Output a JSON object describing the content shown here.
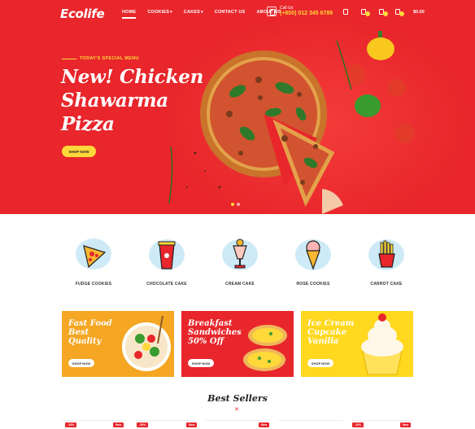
{
  "header": {
    "logo": "Ecolife",
    "nav": [
      {
        "label": "HOME",
        "caret": false,
        "active": true
      },
      {
        "label": "COOKIES",
        "caret": true,
        "active": false
      },
      {
        "label": "CAKES",
        "caret": true,
        "active": false
      },
      {
        "label": "CONTACT US",
        "caret": false,
        "active": false
      },
      {
        "label": "ABOUT US",
        "caret": false,
        "active": false
      }
    ],
    "call_label": "Call Us:",
    "phone": "(+800) 012 345 6789",
    "cart_total": "$0.00",
    "wishlist_count": "0",
    "cart_count": "0"
  },
  "hero": {
    "kicker": "TODAY'S SPECIAL MENU",
    "title_lines": [
      "New! Chicken",
      "Shawarma",
      "Pizza"
    ],
    "button": "SHOP NOW",
    "slides": 2,
    "active_slide": 1
  },
  "categories": [
    {
      "label": "FUDGE COOKIES",
      "icon": "pizza-slice-icon"
    },
    {
      "label": "CHOCOLATE CAKE",
      "icon": "soda-cup-icon"
    },
    {
      "label": "CREAM CAKE",
      "icon": "milkshake-icon"
    },
    {
      "label": "ROSE COOKIES",
      "icon": "ice-cream-cone-icon"
    },
    {
      "label": "CARROT CAKE",
      "icon": "french-fries-icon"
    }
  ],
  "banners": [
    {
      "lines": [
        "Fast Food",
        "Best",
        "Quality"
      ],
      "button": "SHOP NOW",
      "color": "#f5a623"
    },
    {
      "lines": [
        "Breakfast",
        "Sandwiches",
        "50% Off"
      ],
      "button": "SHOP NOW",
      "color": "#e8262b"
    },
    {
      "lines": [
        "Ice Cream",
        "Cupcake",
        "Vanilla"
      ],
      "button": "SHOP NOW",
      "color": "#ffd81f"
    }
  ],
  "best_sellers": {
    "title": "Best Sellers",
    "tags": [
      "-10%",
      "New",
      "-20%",
      "New",
      "New",
      "-10%",
      "New"
    ]
  },
  "colors": {
    "brand_red": "#e8262b",
    "accent_yellow": "#ffd83a"
  }
}
